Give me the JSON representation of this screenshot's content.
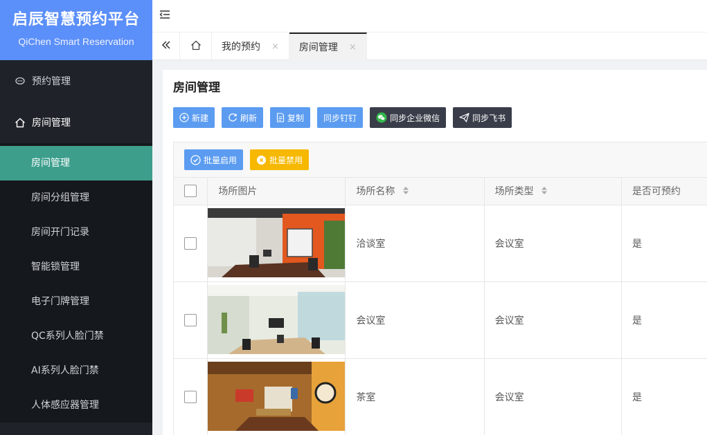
{
  "brand": {
    "title": "启辰智慧预约平台",
    "subtitle": "QiChen Smart Reservation"
  },
  "sidebar": {
    "groups": [
      {
        "label": "预约管理",
        "icon": "chat-icon"
      },
      {
        "label": "房间管理",
        "icon": "home-icon"
      }
    ],
    "items": [
      {
        "label": "房间管理",
        "active": true
      },
      {
        "label": "房间分组管理"
      },
      {
        "label": "房间开门记录"
      },
      {
        "label": "智能锁管理"
      },
      {
        "label": "电子门牌管理"
      },
      {
        "label": "QC系列人脸门禁"
      },
      {
        "label": "AI系列人脸门禁"
      },
      {
        "label": "人体感应器管理"
      }
    ]
  },
  "tabs": [
    {
      "label": "我的预约",
      "close": "×"
    },
    {
      "label": "房间管理",
      "close": "×",
      "active": true
    }
  ],
  "page": {
    "title": "房间管理"
  },
  "toolbar": {
    "new": "新建",
    "refresh": "刷新",
    "copy": "复制",
    "sync_dingtalk": "同步钉钉",
    "sync_wecom": "同步企业微信",
    "sync_feishu": "同步飞书"
  },
  "table_tools": {
    "batch_enable": "批量启用",
    "batch_disable": "批量禁用"
  },
  "table": {
    "headers": [
      "场所图片",
      "场所名称",
      "场所类型",
      "是否可预约"
    ],
    "rows": [
      {
        "name": "洽谈室",
        "type": "会议室",
        "bookable": "是"
      },
      {
        "name": "会议室",
        "type": "会议室",
        "bookable": "是"
      },
      {
        "name": "茶室",
        "type": "会议室",
        "bookable": "是"
      }
    ]
  },
  "colors": {
    "accent": "#5b9cf1",
    "active_menu": "#3d9e8c",
    "sidebar": "#1f2329",
    "brand": "#5b8ff9",
    "warning": "#f6b800"
  }
}
